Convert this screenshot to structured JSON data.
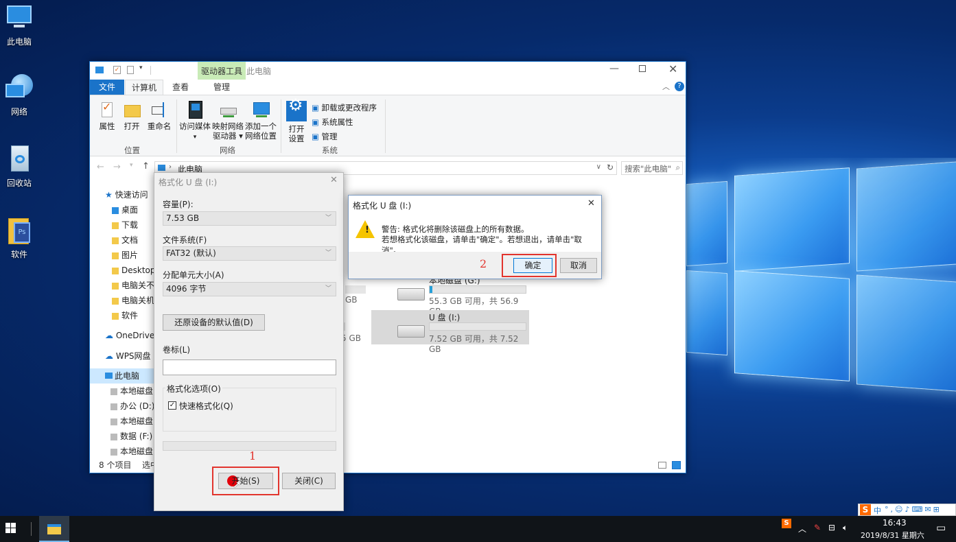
{
  "desktop": {
    "icons": [
      {
        "label": "此电脑"
      },
      {
        "label": "网络"
      },
      {
        "label": "回收站"
      },
      {
        "label": "软件"
      }
    ]
  },
  "explorer": {
    "title": "此电脑",
    "context_tab": "驱动器工具",
    "tabs": [
      "文件",
      "计算机",
      "查看",
      "管理"
    ],
    "ribbon": {
      "properties": "属性",
      "open": "打开",
      "rename": "重命名",
      "access_media": "访问媒体",
      "map_drive_1": "映射网络",
      "map_drive_2": "驱动器 ▾",
      "add_loc_1": "添加一个",
      "add_loc_2": "网络位置",
      "open_settings_1": "打开",
      "open_settings_2": "设置",
      "uninstall": "卸载或更改程序",
      "sys_props": "系统属性",
      "manage": "管理",
      "group_location": "位置",
      "group_network": "网络",
      "group_system": "系统"
    },
    "address": {
      "path": "此电脑",
      "search_placeholder": "搜索\"此电脑\""
    },
    "nav": [
      "快速访问",
      "桌面",
      "下载",
      "文档",
      "图片",
      "Desktop",
      "电脑关不了",
      "电脑关机关",
      "软件",
      "OneDrive",
      "WPS网盘",
      "此电脑",
      "本地磁盘",
      "办公 (D:)",
      "本地磁盘",
      "数据 (F:)",
      "本地磁盘"
    ],
    "drives": [
      {
        "name": "本地磁盘 (G:)",
        "info": "55.3 GB 可用，共 56.9 GB",
        "fill": 0.03
      },
      {
        "name": "U 盘 (I:)",
        "info": "7.52 GB 可用，共 7.52 GB",
        "fill": 0.0
      }
    ],
    "partial": [
      "GB",
      "5 GB"
    ],
    "status": {
      "count": "8 个项目",
      "selected": "选中"
    }
  },
  "format_dialog": {
    "title": "格式化 U 盘 (I:)",
    "capacity_label": "容量(P):",
    "capacity": "7.53 GB",
    "fs_label": "文件系统(F)",
    "fs": "FAT32 (默认)",
    "alloc_label": "分配单元大小(A)",
    "alloc": "4096 字节",
    "restore_btn": "还原设备的默认值(D)",
    "volume_label": "卷标(L)",
    "volume_value": "",
    "options_label": "格式化选项(O)",
    "quick": "快速格式化(Q)",
    "start_btn": "开始(S)",
    "close_btn": "关闭(C)",
    "step": "1"
  },
  "warn_dialog": {
    "title": "格式化 U 盘 (I:)",
    "line1": "警告: 格式化将删除该磁盘上的所有数据。",
    "line2": "若想格式化该磁盘，请单击\"确定\"。若想退出，请单击\"取消\"。",
    "ok": "确定",
    "cancel": "取消",
    "step": "2"
  },
  "taskbar": {
    "time": "16:43",
    "date": "2019/8/31 星期六",
    "ime": "中"
  },
  "colors": {
    "accent": "#1a73c9",
    "ctx_green": "#c9ebb7",
    "highlight": "#e2342d"
  }
}
